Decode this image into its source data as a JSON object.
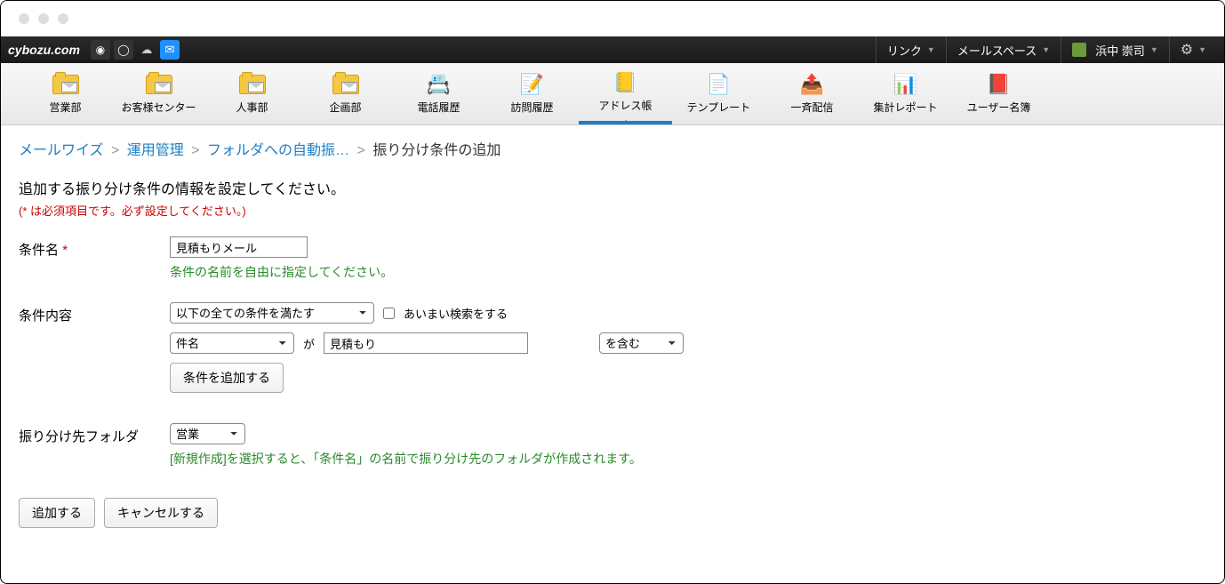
{
  "brand": "cybozu.com",
  "topmenus": {
    "link": "リンク",
    "mailspace": "メールスペース",
    "user": "浜中 崇司"
  },
  "nav": {
    "items": [
      {
        "label": "営業部"
      },
      {
        "label": "お客様センター"
      },
      {
        "label": "人事部"
      },
      {
        "label": "企画部"
      },
      {
        "label": "電話履歴"
      },
      {
        "label": "訪問履歴"
      },
      {
        "label": "アドレス帳"
      },
      {
        "label": "テンプレート"
      },
      {
        "label": "一斉配信"
      },
      {
        "label": "集計レポート"
      },
      {
        "label": "ユーザー名簿"
      }
    ]
  },
  "breadcrumb": {
    "a": "メールワイズ",
    "b": "運用管理",
    "c": "フォルダへの自動振…",
    "current": "振り分け条件の追加"
  },
  "intro": "追加する振り分け条件の情報を設定してください。",
  "note": "(* は必須項目です。必ず設定してください。)",
  "form": {
    "name_label": "条件名",
    "name_value": "見積もりメール",
    "name_hint": "条件の名前を自由に指定してください。",
    "content_label": "条件内容",
    "match_select": "以下の全ての条件を満たす",
    "fuzzy_label": "あいまい検索をする",
    "field_select": "件名",
    "ga": "が",
    "value_input": "見積もり",
    "op_select": "を含む",
    "add_cond_btn": "条件を追加する",
    "folder_label": "振り分け先フォルダ",
    "folder_select": "営業",
    "folder_hint": "[新規作成]を選択すると、「条件名」の名前で振り分け先のフォルダが作成されます。"
  },
  "actions": {
    "submit": "追加する",
    "cancel": "キャンセルする"
  }
}
